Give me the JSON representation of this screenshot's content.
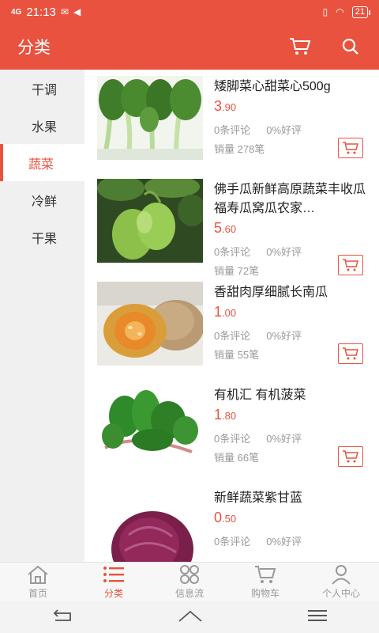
{
  "status": {
    "time": "21:13",
    "signal": "4G",
    "battery": "21"
  },
  "header": {
    "title": "分类"
  },
  "categories": [
    {
      "label": "干调"
    },
    {
      "label": "水果"
    },
    {
      "label": "蔬菜"
    },
    {
      "label": "冷鲜"
    },
    {
      "label": "干果"
    }
  ],
  "active_category": "蔬菜",
  "products": [
    {
      "name": "矮脚菜心甜菜心500g",
      "price_int": "3",
      "price_dec": ".90",
      "reviews": "0条评论",
      "good_rate": "0%好评",
      "sales": "销量 278笔",
      "image": "bok-choy"
    },
    {
      "name": "佛手瓜新鲜高原蔬菜丰收瓜福寿瓜窝瓜农家…",
      "price_int": "5",
      "price_dec": ".60",
      "reviews": "0条评论",
      "good_rate": "0%好评",
      "sales": "销量 72笔",
      "image": "chayote"
    },
    {
      "name": "香甜肉厚细腻长南瓜",
      "price_int": "1",
      "price_dec": ".00",
      "reviews": "0条评论",
      "good_rate": "0%好评",
      "sales": "销量 55笔",
      "image": "pumpkin"
    },
    {
      "name": "有机汇 有机菠菜",
      "price_int": "1",
      "price_dec": ".80",
      "reviews": "0条评论",
      "good_rate": "0%好评",
      "sales": "销量 66笔",
      "image": "spinach"
    },
    {
      "name": "新鲜蔬菜紫甘蓝",
      "price_int": "0",
      "price_dec": ".50",
      "reviews": "0条评论",
      "good_rate": "0%好评",
      "sales": "",
      "image": "red-cabbage"
    }
  ],
  "nav": [
    {
      "label": "首页",
      "icon": "home-icon"
    },
    {
      "label": "分类",
      "icon": "list-icon"
    },
    {
      "label": "信息流",
      "icon": "grid-icon"
    },
    {
      "label": "购物车",
      "icon": "cart-icon"
    },
    {
      "label": "个人中心",
      "icon": "user-icon"
    }
  ],
  "colors": {
    "accent": "#e8523f"
  }
}
